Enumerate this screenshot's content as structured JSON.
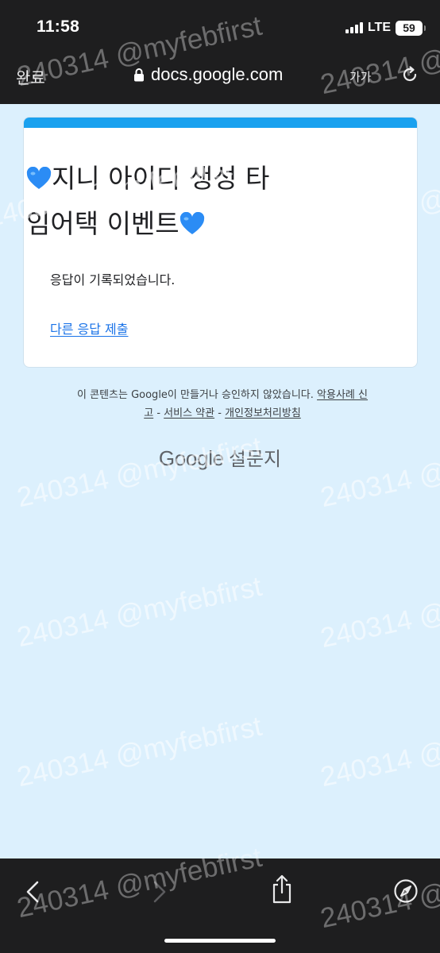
{
  "status_bar": {
    "time": "11:58",
    "network": "LTE",
    "battery": "59"
  },
  "browser": {
    "done_label": "완료",
    "url": "docs.google.com",
    "text_size_label": "가가",
    "icons": [
      "lock-icon",
      "reload-icon",
      "back-icon",
      "forward-icon",
      "share-icon",
      "compass-icon"
    ]
  },
  "form": {
    "title_line1": "지니 아이디 생성 타",
    "title_line2": "임어택 이벤트",
    "confirmation": "응답이 기록되었습니다.",
    "resubmit_link": "다른 응답 제출",
    "accent_color": "#1aa1ef",
    "heart_color": "#2b8cf5"
  },
  "footer": {
    "disclaimer_text": "이 콘텐츠는 Google이 만들거나 승인하지 않았습니다.",
    "report_abuse_1": "악용사례 신",
    "report_abuse_2": "고",
    "sep1": "-",
    "terms": "서비스 약관",
    "sep2": "-",
    "privacy": "개인정보처리방침",
    "brand_google": "Google",
    "brand_forms": "설문지"
  },
  "watermark": {
    "text": "240314 @myfebfirst"
  }
}
